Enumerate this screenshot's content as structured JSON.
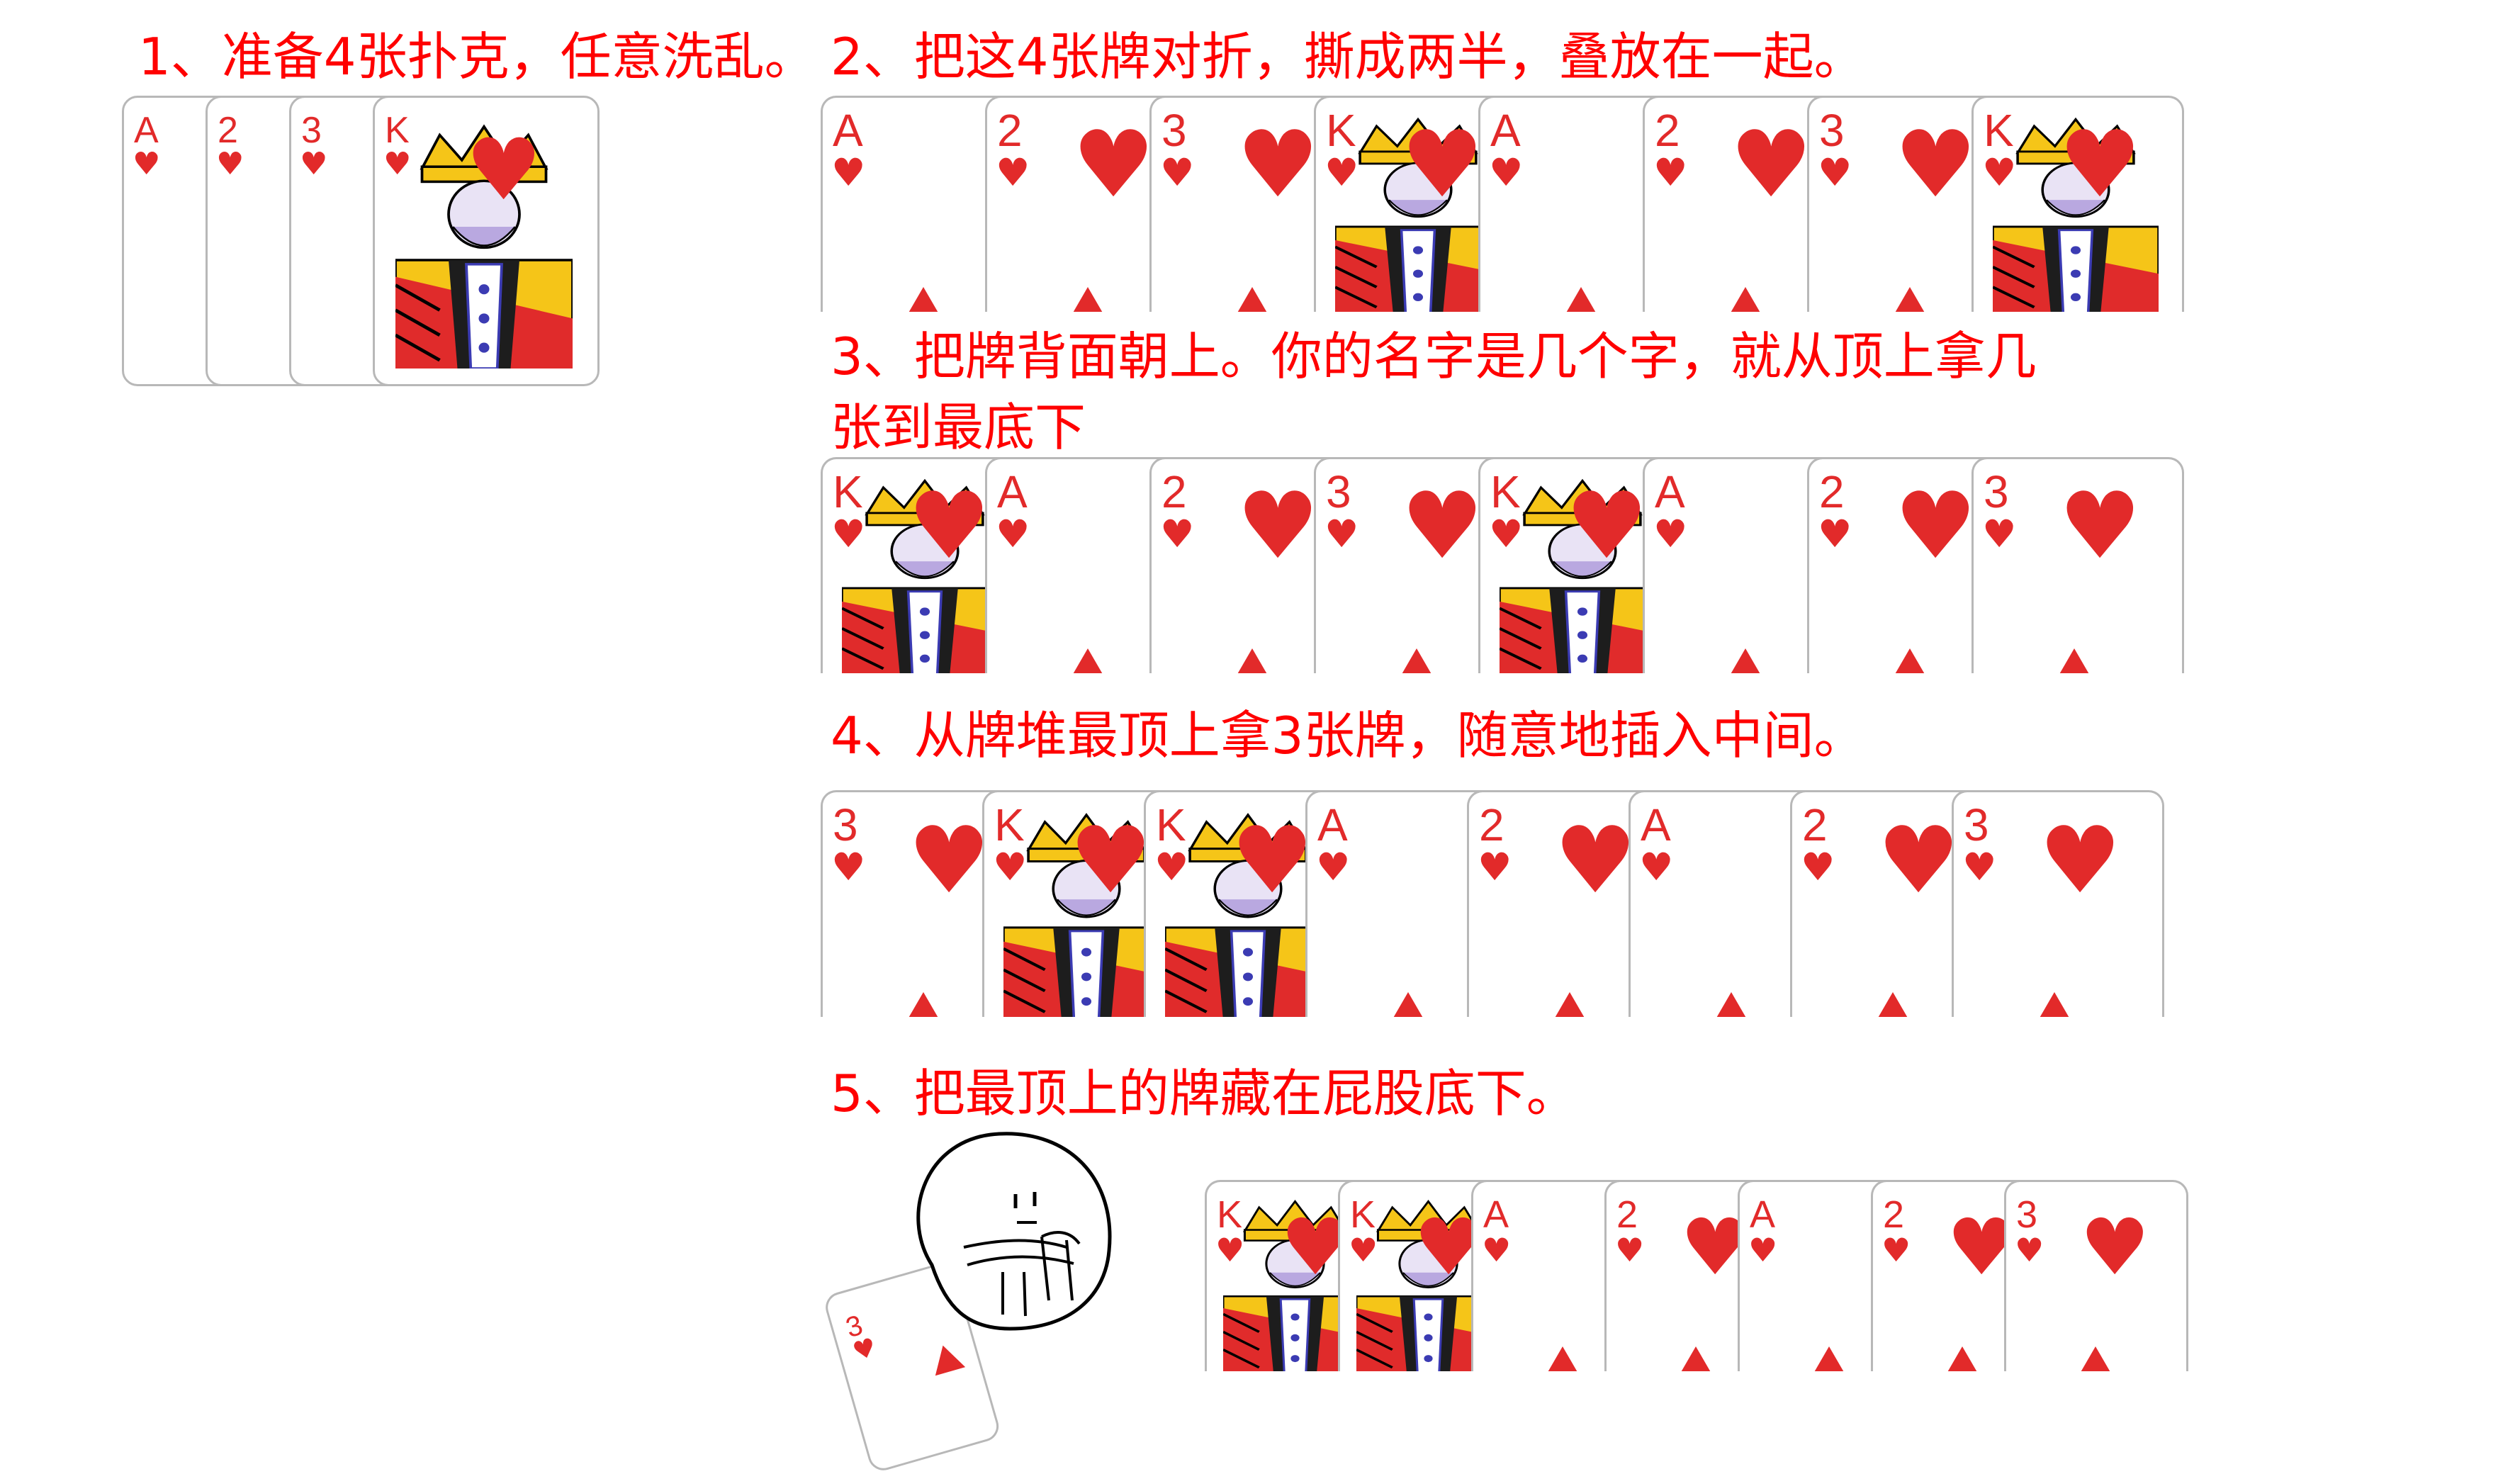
{
  "steps": [
    {
      "text": "1、准备4张扑克，任意洗乱。"
    },
    {
      "text": "2、把这4张牌对折，撕成两半，叠放在一起。"
    },
    {
      "text": "3、把牌背面朝上。你的名字是几个字，就从顶上拿几"
    },
    {
      "text": "张到最底下"
    },
    {
      "text": "4、从牌堆最顶上拿3张牌，随意地插入中间。"
    },
    {
      "text": "5、把最顶上的牌藏在屁股底下。"
    }
  ],
  "rows": {
    "step1": [
      "A",
      "2",
      "3",
      "K"
    ],
    "step2": [
      "A",
      "2",
      "3",
      "K",
      "A",
      "2",
      "3",
      "K"
    ],
    "step3": [
      "K",
      "A",
      "2",
      "3",
      "K",
      "A",
      "2",
      "3"
    ],
    "step4": [
      "3",
      "K",
      "K",
      "A",
      "2",
      "A",
      "2",
      "3"
    ],
    "step5": [
      "K",
      "K",
      "A",
      "2",
      "A",
      "2",
      "3"
    ],
    "step5_hidden": "3"
  },
  "colors": {
    "text": "#ff0000",
    "suit": "#e22a2a",
    "border": "#b8b8b8"
  },
  "icons": {
    "suit": "heart",
    "mascot": "blob-character-sitting"
  }
}
